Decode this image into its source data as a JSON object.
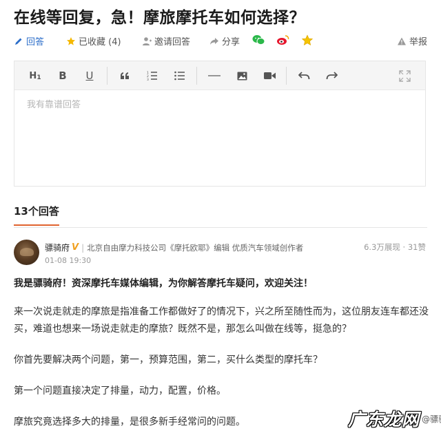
{
  "question": {
    "title": "在线等回复，急！摩旅摩托车如何选择？"
  },
  "actions": {
    "answer": "回答",
    "favorited": "已收藏 (4)",
    "invite": "邀请回答",
    "share": "分享",
    "report": "举报"
  },
  "editor": {
    "toolbar": {
      "h1": "H",
      "bold": "B",
      "underline": "U"
    },
    "placeholder": "我有靠谱回答"
  },
  "answers": {
    "count_label": "13个回答"
  },
  "answer": {
    "author": "骠骑府",
    "badge": "V",
    "author_desc": "北京自由摩力科技公司《摩托欧耶》编辑 优质汽车领域创作者",
    "time": "01-08 19:30",
    "stats": "6.3万展现 · 31赞",
    "paragraphs": [
      "我是骠骑府！资深摩托车媒体编辑，为你解答摩托车疑问，欢迎关注！",
      "来一次说走就走的摩旅是指准备工作都做好了的情况下，兴之所至随性而为，这位朋友连车都还没买，难道也想来一场说走就走的摩旅？既然不是，那怎么叫做在线等，挺急的？",
      "你首先要解决两个问题，第一，预算范围，第二，买什么类型的摩托车？",
      "第一个问题直接决定了排量，动力，配置，价格。",
      "摩旅究竟选择多大的排量，是很多新手经常问的问题。"
    ]
  },
  "watermark": {
    "logo_text": "广东龙网",
    "author_mark": "@骠骑府"
  },
  "colors": {
    "accent_blue": "#2c6ec9",
    "tab_underline": "#e0622e",
    "star": "#f5b800",
    "wechat": "#2bb84a",
    "weibo": "#e6162d"
  }
}
